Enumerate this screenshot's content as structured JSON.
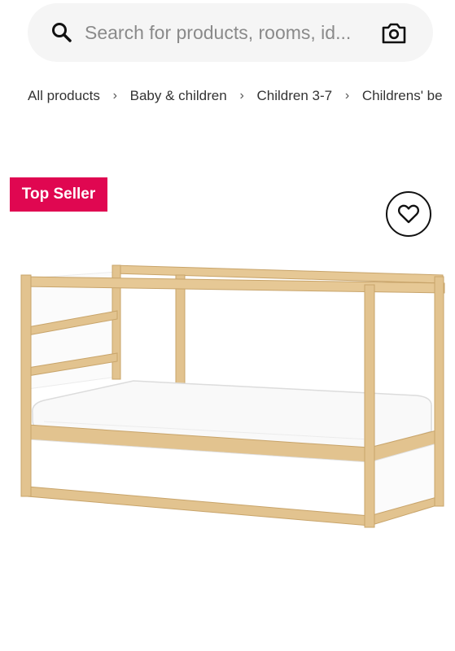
{
  "search": {
    "placeholder": "Search for products, rooms, id...",
    "search_icon": "search-icon",
    "camera_icon": "camera-icon"
  },
  "breadcrumb": {
    "items": [
      "All products",
      "Baby & children",
      "Children 3-7",
      "Childrens' be"
    ],
    "separator": "›"
  },
  "product": {
    "badge": "Top Seller",
    "favourite_icon": "heart-icon",
    "image_subject": "reversible wooden children's bed"
  },
  "colors": {
    "badge": "#e00751",
    "search_background": "#f5f5f5",
    "wood": "#e2c38f",
    "panel": "#ffffff"
  }
}
